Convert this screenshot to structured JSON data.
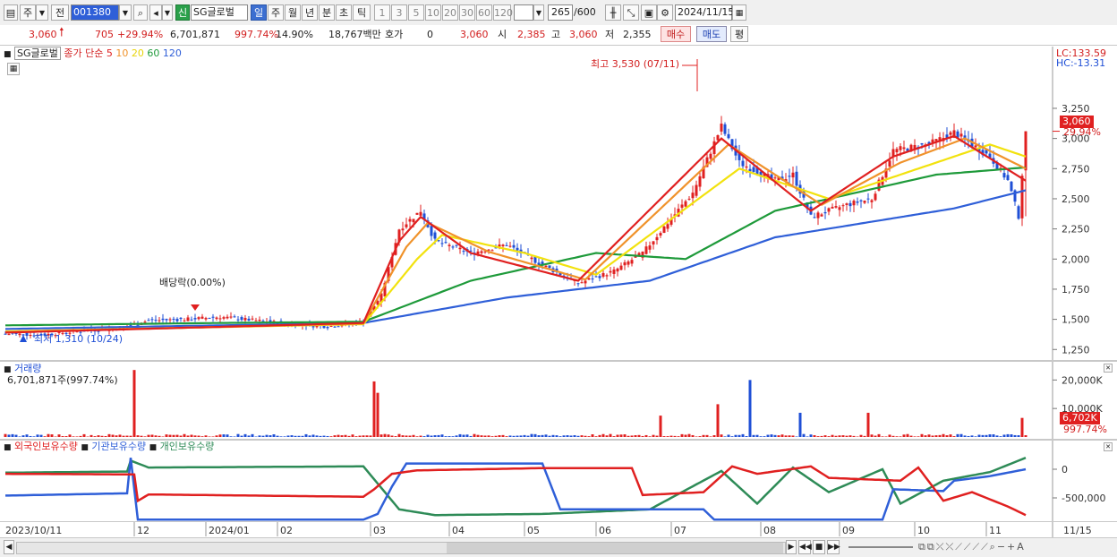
{
  "toolbar": {
    "market": "주",
    "prev": "전",
    "code": "001380",
    "badge": "신",
    "name": "SG글로벌",
    "periods": [
      "일",
      "주",
      "월",
      "년",
      "분",
      "초",
      "틱"
    ],
    "active_period": "일",
    "minutes": [
      "1",
      "3",
      "5",
      "10",
      "20",
      "30",
      "60",
      "120"
    ],
    "count": "265",
    "count_total": "/600",
    "date": "2024/11/15"
  },
  "quote": {
    "price": "3,060",
    "change": "705",
    "change_pct": "+29.94%",
    "volume": "6,701,871",
    "vol_ratio": "997.74%",
    "turnover": "14.90%",
    "amount": "18,767백만",
    "hoga_label": "호가",
    "hoga": "0",
    "hoga_price": "3,060",
    "open_label": "시",
    "open": "2,385",
    "high_label": "고",
    "high": "3,060",
    "low_label": "저",
    "low": "2,355",
    "buy": "매수",
    "sell": "매도",
    "avg": "평"
  },
  "price_panel": {
    "legend_name": "SG글로벌",
    "legend_ma_label": "종가 단순",
    "ma_periods": [
      "5",
      "10",
      "20",
      "60",
      "120"
    ],
    "lc": "LC:133.59",
    "hc": "HC:-13.31",
    "high_note": "최고 3,530 (07/11)",
    "low_note": "최저 1,310 (10/24)",
    "dividend_note": "배당락(0.00%)",
    "last_price": "3,060",
    "last_pct": "29.94%"
  },
  "volume_panel": {
    "title": "거래량",
    "value": "6,701,871주(997.74%)",
    "last_value": "6,702K",
    "last_pct": "997.74%"
  },
  "holding_panel": {
    "series_names": [
      "외국인보유수량",
      "기관보유수량",
      "개인보유수량"
    ]
  },
  "x_axis": {
    "start_label": "2023/10/11",
    "months": [
      "12",
      "2024/01",
      "02",
      "03",
      "04",
      "05",
      "06",
      "07",
      "08",
      "09",
      "10",
      "11"
    ],
    "end_label": "11/15"
  },
  "colors": {
    "ma5": "#e02020",
    "ma10": "#f0922a",
    "ma20": "#f2e20e",
    "ma60": "#1e9a3a",
    "ma120": "#2f5fd8",
    "up": "#e02020",
    "down": "#1f4fd6",
    "foreign": "#e02020",
    "institution": "#2f5fd8",
    "individual": "#2e8b57"
  },
  "chart_data": [
    {
      "type": "candlestick",
      "title": "SG글로벌",
      "y_ticks": [
        1250,
        1500,
        1750,
        2000,
        2250,
        2500,
        2750,
        3000,
        3250
      ],
      "ylim": [
        1200,
        3480
      ],
      "anchors": [
        {
          "i": 0,
          "v": 1380
        },
        {
          "i": 10,
          "v": 1370
        },
        {
          "i": 20,
          "v": 1400
        },
        {
          "i": 30,
          "v": 1420
        },
        {
          "i": 35,
          "v": 1450
        },
        {
          "i": 40,
          "v": 1490
        },
        {
          "i": 50,
          "v": 1500
        },
        {
          "i": 60,
          "v": 1520
        },
        {
          "i": 70,
          "v": 1490
        },
        {
          "i": 80,
          "v": 1460
        },
        {
          "i": 90,
          "v": 1440
        },
        {
          "i": 100,
          "v": 1480
        },
        {
          "i": 105,
          "v": 1700
        },
        {
          "i": 110,
          "v": 2250
        },
        {
          "i": 116,
          "v": 2400
        },
        {
          "i": 120,
          "v": 2150
        },
        {
          "i": 130,
          "v": 2050
        },
        {
          "i": 140,
          "v": 2120
        },
        {
          "i": 150,
          "v": 1950
        },
        {
          "i": 160,
          "v": 1800
        },
        {
          "i": 170,
          "v": 1900
        },
        {
          "i": 178,
          "v": 2050
        },
        {
          "i": 185,
          "v": 2300
        },
        {
          "i": 192,
          "v": 2550
        },
        {
          "i": 200,
          "v": 3100
        },
        {
          "i": 205,
          "v": 2800
        },
        {
          "i": 215,
          "v": 2650
        },
        {
          "i": 220,
          "v": 2700
        },
        {
          "i": 225,
          "v": 2350
        },
        {
          "i": 235,
          "v": 2450
        },
        {
          "i": 242,
          "v": 2500
        },
        {
          "i": 248,
          "v": 2900
        },
        {
          "i": 258,
          "v": 2950
        },
        {
          "i": 265,
          "v": 3050
        },
        {
          "i": 275,
          "v": 2850
        },
        {
          "i": 280,
          "v": 2650
        },
        {
          "i": 283,
          "v": 2355
        },
        {
          "i": 285,
          "v": 3060
        }
      ],
      "ma5_anchor": [
        {
          "i": 0,
          "v": 1390
        },
        {
          "i": 100,
          "v": 1470
        },
        {
          "i": 110,
          "v": 2150
        },
        {
          "i": 116,
          "v": 2350
        },
        {
          "i": 130,
          "v": 2050
        },
        {
          "i": 160,
          "v": 1820
        },
        {
          "i": 200,
          "v": 3000
        },
        {
          "i": 225,
          "v": 2400
        },
        {
          "i": 248,
          "v": 2850
        },
        {
          "i": 265,
          "v": 3020
        },
        {
          "i": 285,
          "v": 2650
        }
      ],
      "ma10_anchor": [
        {
          "i": 0,
          "v": 1395
        },
        {
          "i": 100,
          "v": 1465
        },
        {
          "i": 112,
          "v": 2100
        },
        {
          "i": 118,
          "v": 2300
        },
        {
          "i": 135,
          "v": 2060
        },
        {
          "i": 162,
          "v": 1830
        },
        {
          "i": 202,
          "v": 2950
        },
        {
          "i": 228,
          "v": 2450
        },
        {
          "i": 250,
          "v": 2800
        },
        {
          "i": 268,
          "v": 3000
        },
        {
          "i": 285,
          "v": 2750
        }
      ],
      "ma20_anchor": [
        {
          "i": 0,
          "v": 1400
        },
        {
          "i": 100,
          "v": 1460
        },
        {
          "i": 115,
          "v": 2000
        },
        {
          "i": 122,
          "v": 2200
        },
        {
          "i": 145,
          "v": 2050
        },
        {
          "i": 165,
          "v": 1870
        },
        {
          "i": 205,
          "v": 2750
        },
        {
          "i": 230,
          "v": 2500
        },
        {
          "i": 255,
          "v": 2750
        },
        {
          "i": 275,
          "v": 2950
        },
        {
          "i": 285,
          "v": 2850
        }
      ],
      "ma60_anchor": [
        {
          "i": 0,
          "v": 1450
        },
        {
          "i": 60,
          "v": 1470
        },
        {
          "i": 100,
          "v": 1480
        },
        {
          "i": 130,
          "v": 1820
        },
        {
          "i": 165,
          "v": 2050
        },
        {
          "i": 190,
          "v": 2000
        },
        {
          "i": 215,
          "v": 2400
        },
        {
          "i": 245,
          "v": 2600
        },
        {
          "i": 260,
          "v": 2700
        },
        {
          "i": 285,
          "v": 2760
        }
      ],
      "ma120_anchor": [
        {
          "i": 0,
          "v": 1420
        },
        {
          "i": 100,
          "v": 1470
        },
        {
          "i": 140,
          "v": 1680
        },
        {
          "i": 180,
          "v": 1820
        },
        {
          "i": 215,
          "v": 2180
        },
        {
          "i": 240,
          "v": 2300
        },
        {
          "i": 265,
          "v": 2420
        },
        {
          "i": 285,
          "v": 2570
        }
      ]
    },
    {
      "type": "bar",
      "title": "거래량",
      "y_ticks": [
        10000,
        20000
      ],
      "y_tick_labels": [
        "10,000K",
        "20,000K"
      ],
      "spikes": [
        {
          "i": 36,
          "v": 23500
        },
        {
          "i": 103,
          "v": 19500
        },
        {
          "i": 104,
          "v": 15500
        },
        {
          "i": 183,
          "v": 7500
        },
        {
          "i": 199,
          "v": 11500
        },
        {
          "i": 208,
          "v": 20000
        },
        {
          "i": 222,
          "v": 8500
        },
        {
          "i": 241,
          "v": 8500
        },
        {
          "i": 284,
          "v": 6700
        }
      ]
    },
    {
      "type": "line",
      "title": "외국인보유수량 / 기관보유수량 / 개인보유수량",
      "y_ticks": [
        0,
        -500000
      ],
      "y_tick_labels": [
        "0",
        "-500,000"
      ]
    }
  ]
}
